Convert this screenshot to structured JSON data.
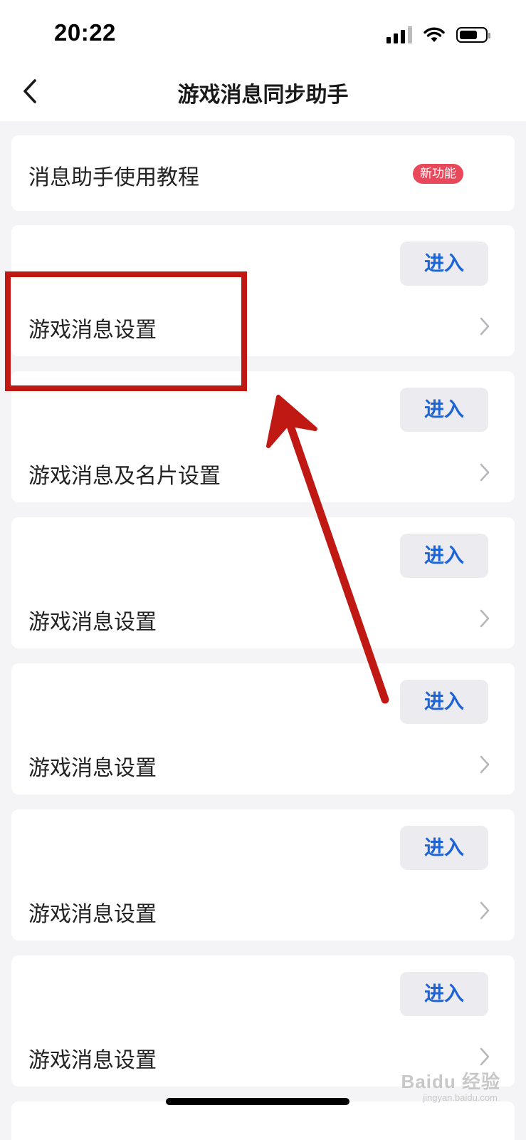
{
  "status_bar": {
    "time": "20:22"
  },
  "nav": {
    "title": "游戏消息同步助手",
    "back_icon": "chevron-left-icon"
  },
  "tutorial": {
    "label": "消息助手使用教程",
    "badge": "新功能",
    "badge_color": "#e8485a"
  },
  "settings": {
    "items": [
      {
        "label": "游戏消息设置",
        "button": "进入"
      },
      {
        "label": "游戏消息及名片设置",
        "button": "进入"
      },
      {
        "label": "游戏消息设置",
        "button": "进入"
      },
      {
        "label": "游戏消息设置",
        "button": "进入"
      },
      {
        "label": "游戏消息设置",
        "button": "进入"
      },
      {
        "label": "游戏消息设置",
        "button": "进入"
      }
    ]
  },
  "annotation": {
    "color": "#c01914"
  },
  "watermark": {
    "text": "Baidu 经验",
    "sub": "jingyan.baidu.com"
  },
  "colors": {
    "accent": "#1d64d6",
    "background": "#f4f4f6",
    "card": "#ffffff"
  }
}
